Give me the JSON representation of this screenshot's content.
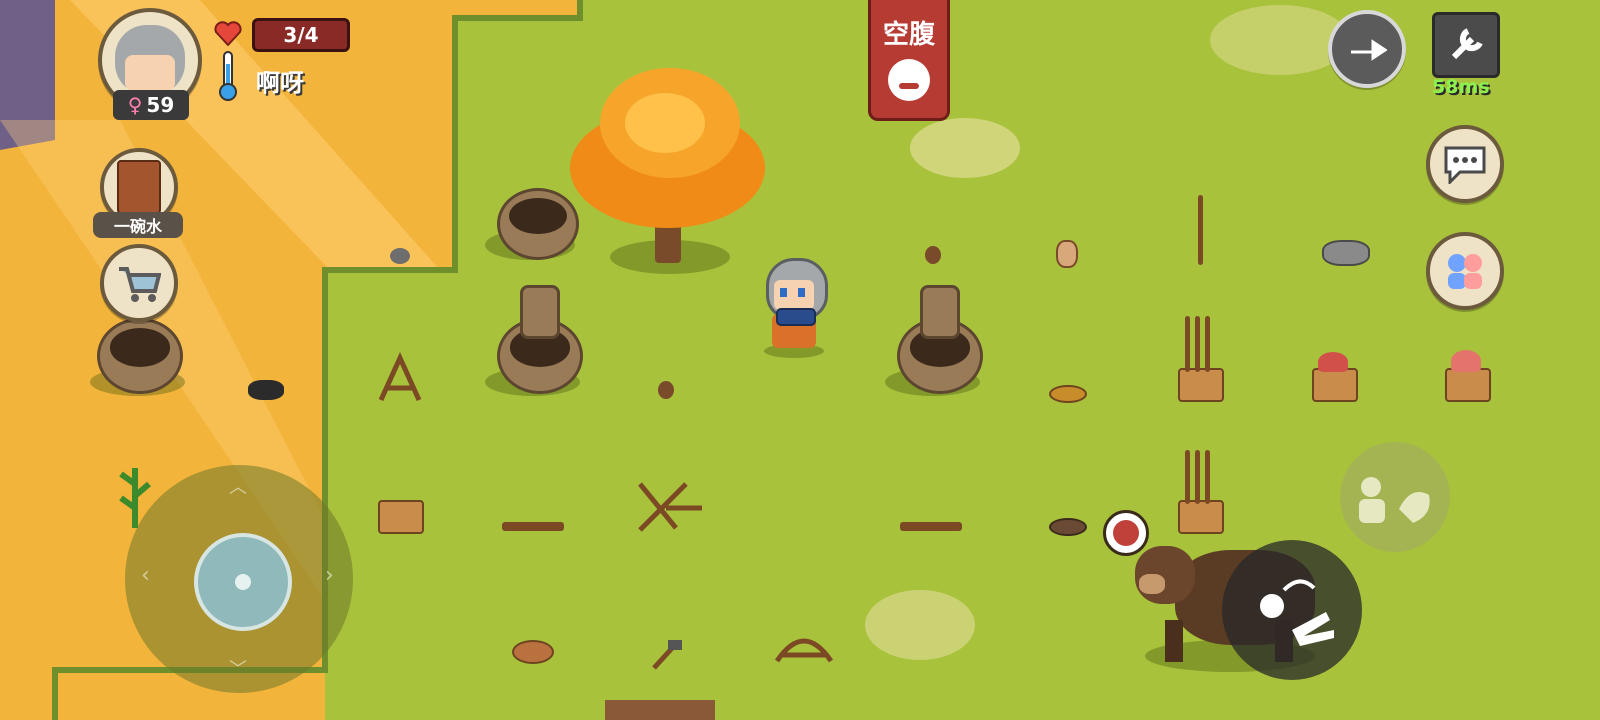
{
  "player": {
    "health_text": "3/4",
    "temperature_text": "啊呀",
    "age_value": "59",
    "gender_symbol": "♀"
  },
  "status_banner": {
    "text": "空腹"
  },
  "held_item": {
    "label": "一碗水"
  },
  "network": {
    "ping_text": "58ms"
  },
  "icons": {
    "health": "heart-icon",
    "temperature": "thermometer-icon",
    "settings": "wrench-icon",
    "chat": "speech-bubble-icon",
    "family": "family-icon",
    "shop": "shopping-cart-icon",
    "arrow": "direction-arrow-icon",
    "recipe": "recipe-book-icon",
    "emote": "emote-icon",
    "use_hand": "hand-use-icon"
  },
  "colors": {
    "grass": "#a9c23c",
    "sand": "#f3b43b",
    "banner_red": "#b63b33",
    "health_red": "#e5483b",
    "ping_green": "#8cf04f"
  }
}
